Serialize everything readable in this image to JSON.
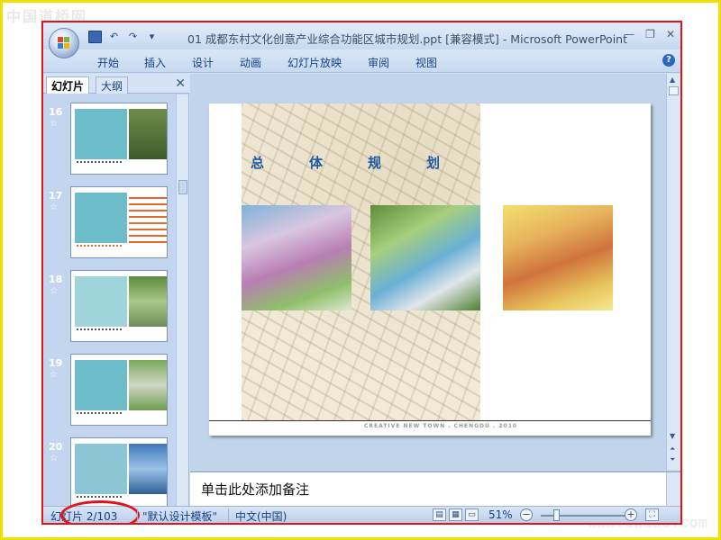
{
  "watermarks": {
    "top": "中国道桥网",
    "bottom": "www.chdao.com"
  },
  "titlebar": {
    "title": "01 成都东村文化创意产业综合功能区城市规划.ppt [兼容模式] - Microsoft PowerPoint",
    "qat": {
      "save": "save-icon",
      "undo": "↶",
      "redo": "↷",
      "more": "▾"
    },
    "controls": {
      "minimize": "—",
      "restore": "❐",
      "close": "✕"
    }
  },
  "ribbon": {
    "tabs": [
      "开始",
      "插入",
      "设计",
      "动画",
      "幻灯片放映",
      "审阅",
      "视图"
    ],
    "help": "?"
  },
  "panel": {
    "tabs": [
      "幻灯片",
      "大纲"
    ],
    "close": "✕",
    "slides": [
      {
        "number": "16",
        "mark": "☆"
      },
      {
        "number": "17",
        "mark": "☆"
      },
      {
        "number": "18",
        "mark": "☆"
      },
      {
        "number": "19",
        "mark": "☆"
      },
      {
        "number": "20",
        "mark": "☆"
      }
    ]
  },
  "slide": {
    "title_chars": [
      "总",
      "体",
      "规",
      "划"
    ],
    "footer": "CREATIVE NEW TOWN . CHENGDU .     2010"
  },
  "notes": {
    "placeholder": "单击此处添加备注"
  },
  "status": {
    "slide_pos": "幻灯片 2/103",
    "template": "\"默认设计模板\"",
    "language": "中文(中国)",
    "zoom": "51%",
    "zoom_value": 0.51,
    "zoom_out": "−",
    "zoom_in": "+"
  },
  "colors": {
    "accent_border": "#e2131b",
    "frame": "#f0e000",
    "title_blue": "#1f5aa6"
  }
}
